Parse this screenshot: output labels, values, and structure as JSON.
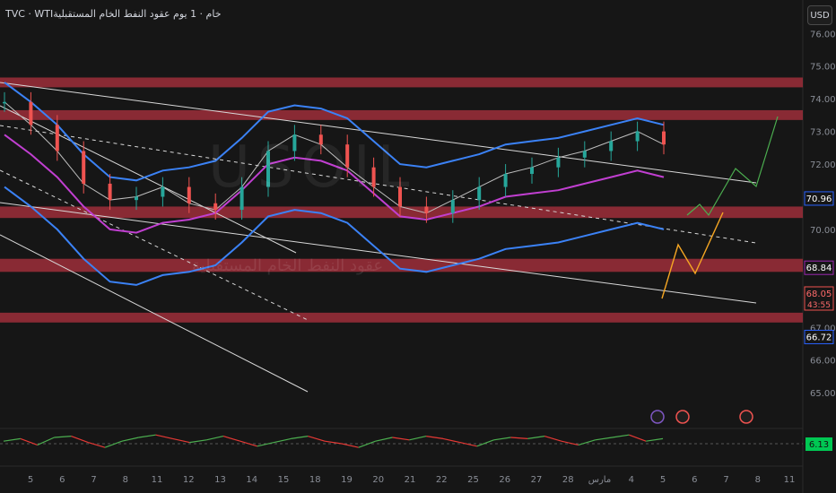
{
  "header": {
    "title": "TVC · WTIﺧﺎﻡ · 1 ﻳﻮﻡ ﻋﻘﻮﺩ ﺍﻟﻨﻔﻂ ﺍﻟﺨﺎﻡ ﺍﻟﻤﺴﺘﻘﺒﻠﻴﺔ",
    "currency": "USD"
  },
  "watermark": {
    "symbol": "USOIL",
    "caption": "ﻋﻘﻮﺩ ﺍﻟﻨﻔﻂ ﺍﻟﺨﺎﻡ ﺍﻟﻤﺴﺘﻘﺒﻠﻴﺔ"
  },
  "colors": {
    "background": "#161616",
    "resistance_zone": "#b0313f",
    "bollinger": "#3b82f6",
    "moving_average": "#c13fd1",
    "projection_up": "#4caf50",
    "projection_orange": "#f5a623",
    "rsi_up": "#26a69a",
    "rsi_down": "#ef5350"
  },
  "chart_data": {
    "type": "line",
    "ylim": [
      64.4,
      76.2
    ],
    "y_ticks": [
      65.0,
      66.0,
      67.0,
      70.0,
      72.0,
      73.0,
      74.0,
      75.0,
      76.0
    ],
    "x_ticks": [
      "5",
      "6",
      "7",
      "8",
      "11",
      "12",
      "13",
      "14",
      "15",
      "18",
      "19",
      "20",
      "21",
      "22",
      "25",
      "26",
      "27",
      "28",
      "ﻣﺎﺭﺱ",
      "4",
      "5",
      "6",
      "7",
      "8",
      "11"
    ],
    "price_labels": [
      {
        "value": 70.96,
        "label": "70.96",
        "color": "#2962ff"
      },
      {
        "value": 68.84,
        "label": "68.84",
        "color": "#9c27b0"
      },
      {
        "value": 68.05,
        "label": "68.05",
        "sub": "43:55",
        "color": "#ef5350"
      },
      {
        "value": 66.72,
        "label": "66.72",
        "color": "#2962ff"
      }
    ],
    "resistance_zones": [
      {
        "low": 74.35,
        "high": 74.65
      },
      {
        "low": 73.35,
        "high": 73.65
      },
      {
        "low": 70.35,
        "high": 70.7
      },
      {
        "low": 68.7,
        "high": 69.1
      },
      {
        "low": 67.15,
        "high": 67.45
      }
    ],
    "series": [
      {
        "name": "",
        "role": "price",
        "x": [
          0,
          1,
          2,
          3,
          4,
          5,
          6,
          7,
          8,
          9,
          10,
          11,
          12,
          13,
          14,
          15,
          16,
          17,
          18,
          19,
          20,
          21,
          22,
          23,
          24,
          25
        ],
        "values": [
          73.9,
          73.2,
          72.4,
          71.4,
          70.9,
          71.0,
          71.3,
          70.8,
          70.6,
          71.3,
          72.4,
          72.9,
          72.6,
          71.9,
          71.3,
          70.7,
          70.5,
          70.9,
          71.3,
          71.7,
          71.9,
          72.2,
          72.4,
          72.7,
          73.0,
          72.6
        ]
      },
      {
        "name": "",
        "role": "upper-band",
        "x": [
          0,
          1,
          2,
          3,
          4,
          5,
          6,
          7,
          8,
          9,
          10,
          11,
          12,
          13,
          14,
          15,
          16,
          17,
          18,
          19,
          20,
          21,
          22,
          23,
          24,
          25
        ],
        "values": [
          74.5,
          73.9,
          73.2,
          72.3,
          71.6,
          71.5,
          71.8,
          71.9,
          72.1,
          72.8,
          73.6,
          73.8,
          73.7,
          73.4,
          72.7,
          72.0,
          71.9,
          72.1,
          72.3,
          72.6,
          72.7,
          72.8,
          73.0,
          73.2,
          73.4,
          73.2
        ]
      }
    ],
    "rsi": {
      "reference": 6.13,
      "label": "6.13",
      "values": [
        0.2,
        0.4,
        -0.1,
        0.5,
        0.6,
        0.1,
        -0.3,
        0.2,
        0.5,
        0.7,
        0.4,
        0.1,
        0.3,
        0.6,
        0.2,
        -0.2,
        0.1,
        0.4,
        0.6,
        0.2,
        0.0,
        -0.3,
        0.2,
        0.5,
        0.3,
        0.6,
        0.4,
        0.1,
        -0.2,
        0.3,
        0.5,
        0.4,
        0.6,
        0.2,
        -0.1,
        0.3,
        0.5,
        0.7,
        0.2,
        0.4
      ]
    }
  }
}
